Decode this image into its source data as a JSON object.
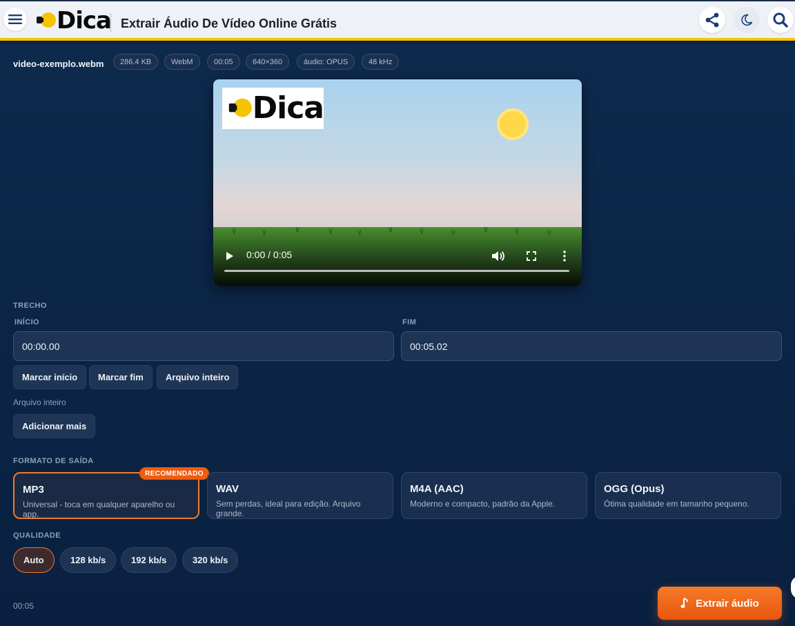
{
  "header": {
    "logo_text": "Dica",
    "title": "Extrair Áudio De Vídeo Online Grátis",
    "icons": [
      "menu-icon",
      "share-icon",
      "moon-icon",
      "search-icon"
    ]
  },
  "file": {
    "name": "video-exemplo.webm",
    "chips": [
      "286.4 KB",
      "WebM",
      "00:05",
      "640×360",
      "áudio: OPUS",
      "48 kHz"
    ]
  },
  "video": {
    "logo_text": "Dica",
    "time": "0:00 / 0:05",
    "progress": 0
  },
  "trecho": {
    "section_label": "TRECHO",
    "start_label": "INÍCIO",
    "end_label": "FIM",
    "start_value": "00:00.00",
    "end_value": "00:05.02",
    "buttons": [
      "Marcar início",
      "Marcar fim",
      "Arquivo inteiro"
    ],
    "range_note": "Arquivo inteiro",
    "add_more": "Adicionar mais"
  },
  "format": {
    "section_label": "FORMATO DE SAÍDA",
    "badge": "RECOMENDADO",
    "options": [
      {
        "title": "MP3",
        "desc": "Universal - toca em qualquer aparelho ou app."
      },
      {
        "title": "WAV",
        "desc": "Sem perdas, ideal para edição. Arquivo grande."
      },
      {
        "title": "M4A (AAC)",
        "desc": "Moderno e compacto, padrão da Apple."
      },
      {
        "title": "OGG (Opus)",
        "desc": "Ótima qualidade em tamanho pequeno."
      }
    ],
    "selected": "MP3"
  },
  "quality": {
    "section_label": "QUALIDADE",
    "options": [
      "Auto",
      "128 kb/s",
      "192 kb/s",
      "320 kb/s"
    ],
    "selected": "Auto"
  },
  "footer": {
    "duration": "00:05",
    "extract_label": "Extrair áudio"
  },
  "colors": {
    "accent": "#f07a2e",
    "brand_yellow": "#f6c300",
    "background": "#0c2343"
  }
}
